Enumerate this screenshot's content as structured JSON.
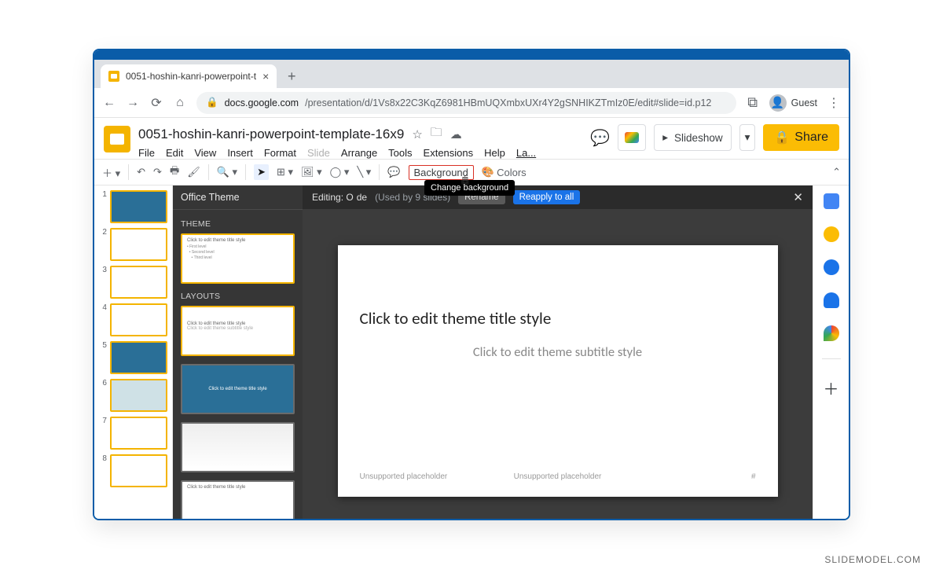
{
  "window": {
    "tab_title": "0051-hoshin-kanri-powerpoint-t",
    "url_host": "docs.google.com",
    "url_path": "/presentation/d/1Vs8x22C3KqZ6981HBmUQXmbxUXr4Y2gSNHIKZTmIz0E/edit#slide=id.p12",
    "guest_label": "Guest"
  },
  "doc": {
    "title": "0051-hoshin-kanri-powerpoint-template-16x9",
    "menus": [
      "File",
      "Edit",
      "View",
      "Insert",
      "Format",
      "Slide",
      "Arrange",
      "Tools",
      "Extensions",
      "Help",
      "La..."
    ],
    "slideshow_label": "Slideshow",
    "share_label": "Share"
  },
  "toolbar": {
    "background_label": "Background",
    "colors_label": "Colors",
    "tooltip": "Change background"
  },
  "theme_panel": {
    "title": "Office Theme",
    "section_theme": "THEME",
    "section_layouts": "LAYOUTS",
    "master_text": "Click to edit theme title style",
    "layout_line1": "Click to edit theme title style",
    "layout_line2": "Click to edit theme subtitle style",
    "layout_blue_text": "Click to edit theme title style"
  },
  "edit_bar": {
    "prefix": "Editing: O",
    "suffix": "de",
    "used_by": "(Used by 9 slides)",
    "rename": "Rename",
    "reapply": "Reapply to all"
  },
  "slide": {
    "title": "Click to edit theme title style",
    "subtitle": "Click to edit theme subtitle style",
    "ph_left": "Unsupported placeholder",
    "ph_center": "Unsupported placeholder",
    "ph_right": "#"
  },
  "slide_numbers": [
    "1",
    "2",
    "3",
    "4",
    "5",
    "6",
    "7",
    "8"
  ],
  "watermark": "SLIDEMODEL.COM"
}
